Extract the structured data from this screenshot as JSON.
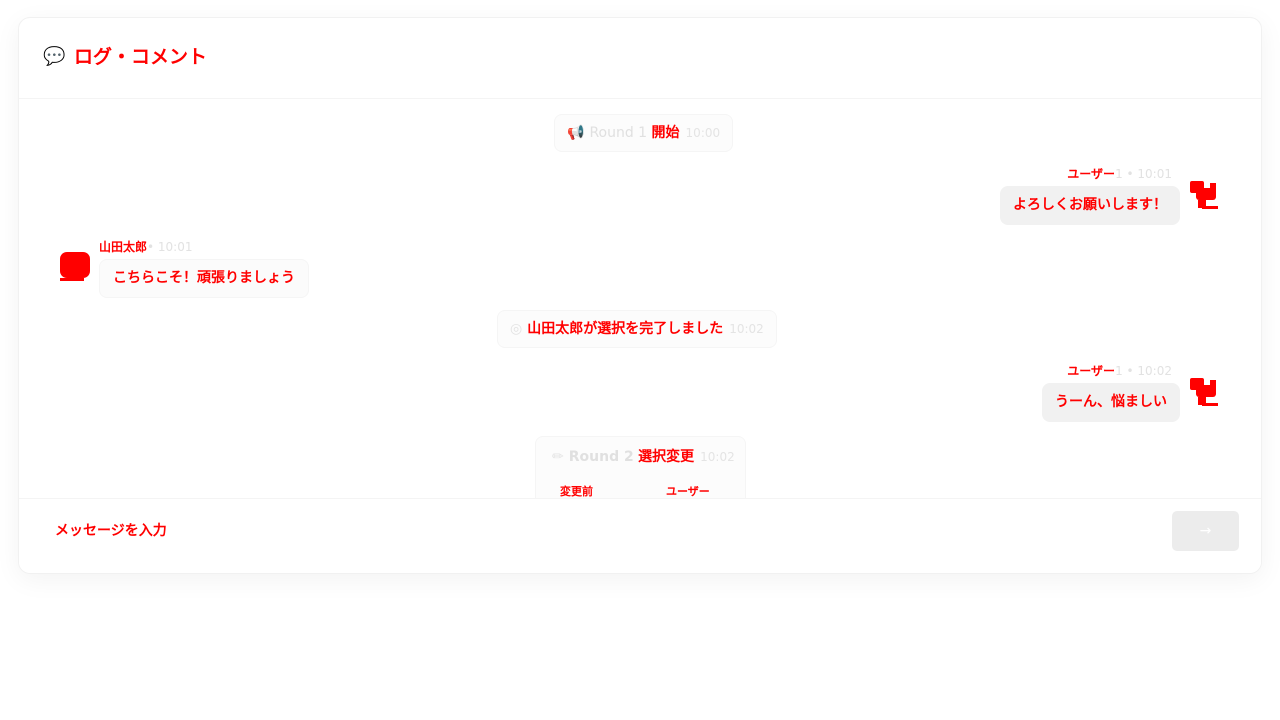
{
  "header": {
    "icon": "speech-bubble-icon",
    "icon_glyph": "💬",
    "title": "ログ・コメント"
  },
  "messages": [
    {
      "kind": "system",
      "icon": "megaphone-icon",
      "icon_glyph": "📢",
      "text_light": "Round 1",
      "text_red": "開始",
      "time": "10:00"
    },
    {
      "kind": "outgoing",
      "author": "ユーザー",
      "author_rest": "1 • 10:01",
      "text": "よろしくお願いします！",
      "avatar": "user-avatar-icon"
    },
    {
      "kind": "incoming",
      "author": "山田太郎",
      "author_rest": "• 10:01",
      "text": "こちらこそ！頑張りましょう",
      "avatar": "user-avatar-icon"
    },
    {
      "kind": "system",
      "icon": "target-icon",
      "icon_glyph": "◎",
      "text_light": "",
      "text_red": "山田太郎が選択を完了しました",
      "time": "10:02"
    },
    {
      "kind": "outgoing",
      "author": "ユーザー",
      "author_rest": "1 • 10:02",
      "text": "うーん、悩ましい",
      "avatar": "user-avatar-icon"
    },
    {
      "kind": "system",
      "icon": "pencil-icon",
      "icon_glyph": "✏",
      "text_light": "Round 2",
      "text_red": "選択変更",
      "time": "10:02",
      "change_from": "変更前",
      "change_to": "ユーザー"
    }
  ],
  "composer": {
    "placeholder": "メッセージを入力",
    "send_label": "→"
  },
  "colors": {
    "accent": "#ff0000",
    "bubble_out": "#f1f1f1",
    "muted": "#e2e2e2"
  }
}
